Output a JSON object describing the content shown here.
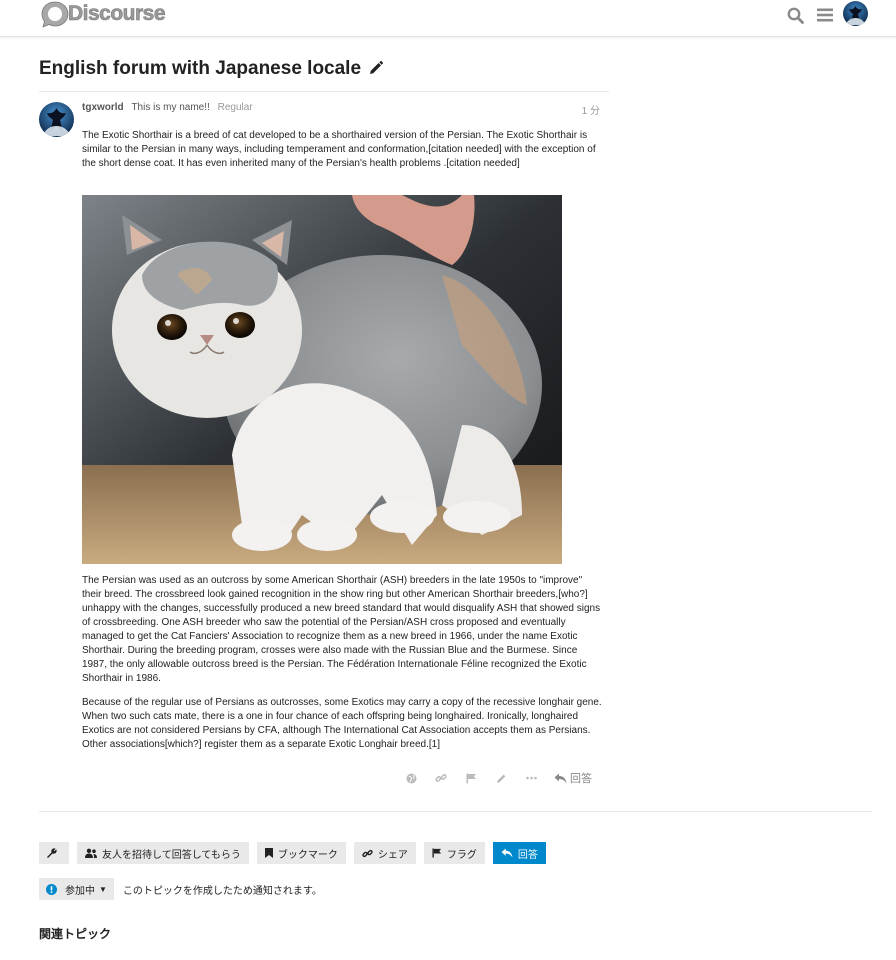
{
  "header": {
    "logo_text": "Discourse",
    "search_icon": "search-icon",
    "menu_icon": "hamburger-menu-icon",
    "avatar_icon": "user-avatar"
  },
  "topic": {
    "title": "English forum with Japanese locale"
  },
  "post": {
    "username": "tgxworld",
    "full_name": "This is my name!!",
    "user_title": "Regular",
    "time": "1 分",
    "paragraph1": "The Exotic Shorthair is a breed of cat developed to be a shorthaired version of the Persian. The Exotic Shorthair is similar to the Persian in many ways, including temperament and conformation,[citation needed] with the exception of the short dense coat. It has even inherited many of the Persian's health problems .[citation needed]",
    "paragraph2": "The Persian was used as an outcross by some American Shorthair (ASH) breeders in the late 1950s to \"improve\" their breed. The crossbreed look gained recognition in the show ring but other American Shorthair breeders,[who?] unhappy with the changes, successfully produced a new breed standard that would disqualify ASH that showed signs of crossbreeding. One ASH breeder who saw the potential of the Persian/ASH cross proposed and eventually managed to get the Cat Fanciers' Association to recognize them as a new breed in 1966, under the name Exotic Shorthair. During the breeding program, crosses were also made with the Russian Blue and the Burmese. Since 1987, the only allowable outcross breed is the Persian. The Fédération Internationale Féline recognized the Exotic Shorthair in 1986.",
    "paragraph3": "Because of the regular use of Persians as outcrosses, some Exotics may carry a copy of the recessive longhair gene. When two such cats mate, there is a one in four chance of each offspring being longhaired. Ironically, longhaired Exotics are not considered Persians by CFA, although The International Cat Association accepts them as Persians. Other associations[which?] register them as a separate Exotic Longhair breed.[1]",
    "reply_label": "回答"
  },
  "footer": {
    "invite_label": "友人を招待して回答してもらう",
    "bookmark_label": "ブックマーク",
    "share_label": "シェア",
    "flag_label": "フラグ",
    "reply_label": "回答"
  },
  "notifications": {
    "level_label": "参加中",
    "reason_text": "このトピックを作成したため通知されます。"
  },
  "related": {
    "heading": "関連トピック"
  },
  "colors": {
    "primary": "#0088cc",
    "button_bg": "#e9e9e9",
    "muted_text": "#999999"
  }
}
